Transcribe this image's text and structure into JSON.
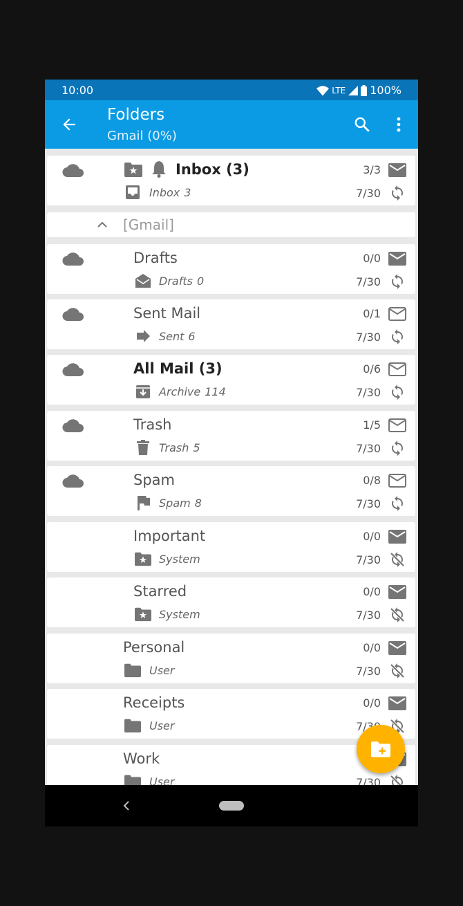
{
  "status": {
    "time": "10:00",
    "network": "LTE",
    "battery": "100%"
  },
  "appbar": {
    "title": "Folders",
    "subtitle": "Gmail (0%)"
  },
  "inbox": {
    "name": "Inbox (3)",
    "type": "Inbox",
    "count": "3",
    "counts": "3/3",
    "sync": "7/30"
  },
  "group_header": {
    "label": "[Gmail]"
  },
  "folders": [
    {
      "name": "Drafts",
      "type": "Drafts",
      "count": "0",
      "counts": "0/0",
      "sync": "7/30"
    },
    {
      "name": "Sent Mail",
      "type": "Sent",
      "count": "6",
      "counts": "0/1",
      "sync": "7/30"
    },
    {
      "name": "All Mail (3)",
      "type": "Archive",
      "count": "114",
      "counts": "0/6",
      "sync": "7/30"
    },
    {
      "name": "Trash",
      "type": "Trash",
      "count": "5",
      "counts": "1/5",
      "sync": "7/30"
    },
    {
      "name": "Spam",
      "type": "Spam",
      "count": "8",
      "counts": "0/8",
      "sync": "7/30"
    },
    {
      "name": "Important",
      "type": "System",
      "counts": "0/0",
      "sync": "7/30"
    },
    {
      "name": "Starred",
      "type": "System",
      "counts": "0/0",
      "sync": "7/30"
    },
    {
      "name": "Personal",
      "type": "User",
      "counts": "0/0",
      "sync": "7/30"
    },
    {
      "name": "Receipts",
      "type": "User",
      "counts": "0/0",
      "sync": "7/30"
    },
    {
      "name": "Work",
      "type": "User",
      "sync": "7/30"
    }
  ],
  "icons": {
    "cloud": "cloud-icon",
    "mail": "mail-icon",
    "sync": "sync-icon",
    "sync_off": "sync-off-icon",
    "fab": "create-folder-icon"
  },
  "colors": {
    "appbar": "#0a9be4",
    "statusbar": "#0a74b8",
    "fab": "#ffb300"
  }
}
